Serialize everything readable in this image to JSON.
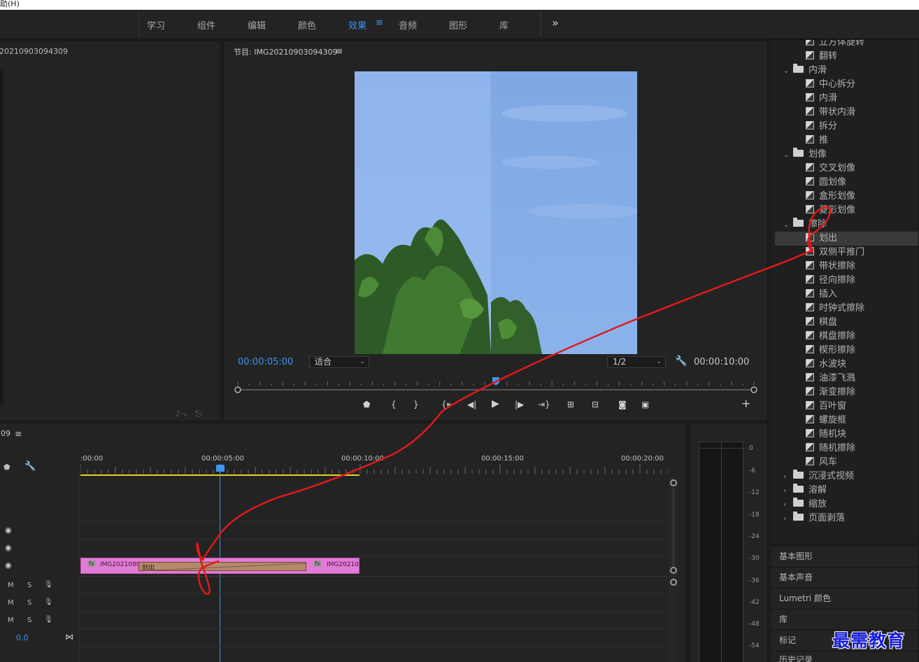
{
  "menubar": {
    "partial_text": "助(H)"
  },
  "workspace": {
    "tabs": [
      "学习",
      "组件",
      "编辑",
      "颜色",
      "效果",
      "音频",
      "图形",
      "库"
    ],
    "active_tab": "效果",
    "more": "»",
    "menu_glyph": "≡"
  },
  "source_monitor": {
    "title": "20210903094309"
  },
  "program_monitor": {
    "title": "节目: IMG20210903094309",
    "menu_glyph": "≡",
    "current_time": "00:00:05:00",
    "fit_select": "适合",
    "resolution_select": "1/2",
    "duration": "00:00:10:00",
    "playhead_fraction": 0.5
  },
  "timeline": {
    "sequence_label": "09",
    "menu_glyph": "≡",
    "ruler_labels": [
      ":00:00",
      "00:00:05:00",
      "00:00:10:00",
      "00:00:15:00",
      "00:00:20:00"
    ],
    "playhead_time": "00:00:05:00",
    "clip_left_label": "IMG2021090",
    "clip_right_label": "IMG20210",
    "transition_label": "划出",
    "fx_badge": "fx",
    "audio_tracks": [
      {
        "m": "M",
        "s": "S"
      },
      {
        "m": "M",
        "s": "S"
      },
      {
        "m": "M",
        "s": "S"
      }
    ],
    "master_value": "0.0"
  },
  "audio_meter": {
    "labels": [
      "0",
      "-6",
      "-12",
      "-18",
      "-24",
      "-30",
      "-36",
      "-42",
      "-48",
      "-54"
    ]
  },
  "effects": {
    "items": [
      {
        "kind": "effect",
        "label": "立方体旋转"
      },
      {
        "kind": "effect",
        "label": "翻转"
      },
      {
        "kind": "folder",
        "label": "内滑",
        "open": true
      },
      {
        "kind": "effect",
        "label": "中心拆分"
      },
      {
        "kind": "effect",
        "label": "内滑"
      },
      {
        "kind": "effect",
        "label": "带状内滑"
      },
      {
        "kind": "effect",
        "label": "拆分"
      },
      {
        "kind": "effect",
        "label": "推"
      },
      {
        "kind": "folder",
        "label": "划像",
        "open": true
      },
      {
        "kind": "effect",
        "label": "交叉划像"
      },
      {
        "kind": "effect",
        "label": "圆划像"
      },
      {
        "kind": "effect",
        "label": "盒形划像"
      },
      {
        "kind": "effect",
        "label": "菱形划像"
      },
      {
        "kind": "folder",
        "label": "擦除",
        "open": true
      },
      {
        "kind": "effect",
        "label": "划出",
        "selected": true
      },
      {
        "kind": "effect",
        "label": "双侧平推门"
      },
      {
        "kind": "effect",
        "label": "带状擦除"
      },
      {
        "kind": "effect",
        "label": "径向擦除"
      },
      {
        "kind": "effect",
        "label": "插入"
      },
      {
        "kind": "effect",
        "label": "时钟式擦除"
      },
      {
        "kind": "effect",
        "label": "棋盘"
      },
      {
        "kind": "effect",
        "label": "棋盘擦除"
      },
      {
        "kind": "effect",
        "label": "楔形擦除"
      },
      {
        "kind": "effect",
        "label": "水波块"
      },
      {
        "kind": "effect",
        "label": "油漆飞溅"
      },
      {
        "kind": "effect",
        "label": "渐变擦除"
      },
      {
        "kind": "effect",
        "label": "百叶窗"
      },
      {
        "kind": "effect",
        "label": "螺旋框"
      },
      {
        "kind": "effect",
        "label": "随机块"
      },
      {
        "kind": "effect",
        "label": "随机擦除"
      },
      {
        "kind": "effect",
        "label": "风车"
      },
      {
        "kind": "folder",
        "label": "沉浸式视频",
        "open": false
      },
      {
        "kind": "folder",
        "label": "溶解",
        "open": false
      },
      {
        "kind": "folder",
        "label": "缩放",
        "open": false
      },
      {
        "kind": "folder",
        "label": "页面剥落",
        "open": false
      }
    ]
  },
  "side_panels": [
    "基本图形",
    "基本声音",
    "Lumetri 颜色",
    "库",
    "标记",
    "历史记录"
  ],
  "watermark": "最需教育",
  "colors": {
    "accent_blue": "#3c95f0",
    "clip_pink": "#e27bd6",
    "transition_tan": "#b48a6a",
    "work_area_yellow": "#e8d327",
    "annotation_red": "#e0191b"
  }
}
